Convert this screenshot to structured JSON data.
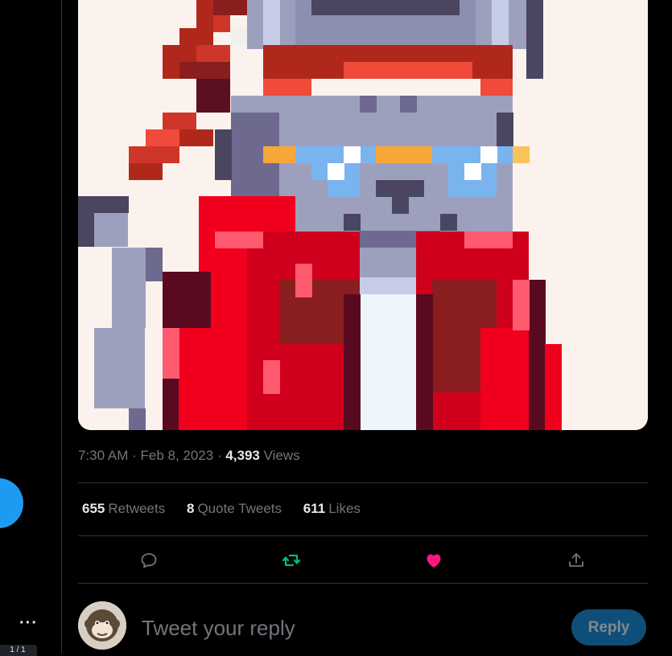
{
  "tweet": {
    "time": "7:30 AM",
    "separator": " · ",
    "date": "Feb 8, 2023",
    "views_count": "4,393",
    "views_label": " Views",
    "image_alt_icon": "pixel-art-cat-icon"
  },
  "stats": {
    "retweets_count": "655",
    "retweets_label": "Retweets",
    "quotes_count": "8",
    "quotes_label": "Quote Tweets",
    "likes_count": "611",
    "likes_label": "Likes"
  },
  "actions": {
    "reply_icon": "reply-icon",
    "retweet_icon": "retweet-icon",
    "like_icon": "heart-icon",
    "share_icon": "share-icon",
    "retweet_color": "#00ba7c",
    "like_color": "#f91880"
  },
  "reply": {
    "placeholder": "Tweet your reply",
    "button_label": "Reply"
  },
  "sidebar": {
    "more_label": "···",
    "page_indicator": "1 / 1"
  },
  "colors": {
    "accent": "#1d9bf0",
    "background": "#000000",
    "text_primary": "#e7e9ea",
    "text_secondary": "#71767b",
    "border": "#2f3336"
  }
}
